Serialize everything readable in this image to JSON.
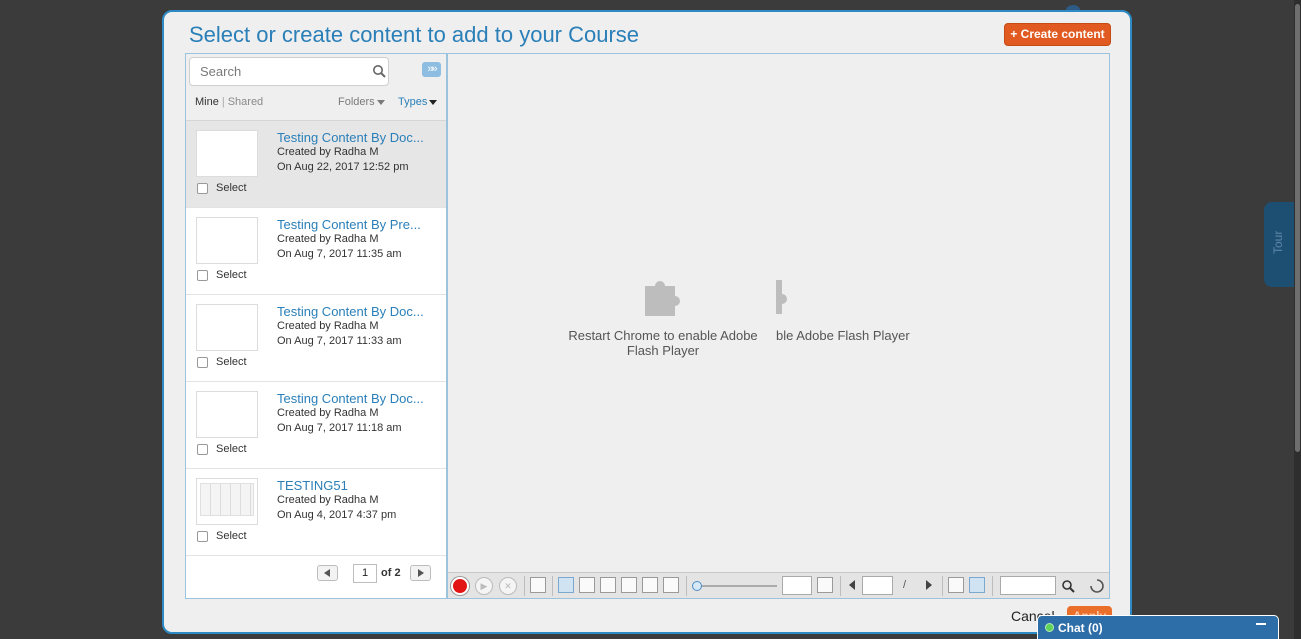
{
  "modal": {
    "title": "Select or create content to add to your Course",
    "create_button": "+ Create content",
    "cancel_label": "Cancel",
    "apply_label": "Apply"
  },
  "left_panel": {
    "search_placeholder": "Search",
    "filter_mine": "Mine",
    "filter_separator": "|",
    "filter_shared": "Shared",
    "folders_label": "Folders",
    "types_label": "Types"
  },
  "items": [
    {
      "title": "Testing Content By Doc...",
      "created_by": "Created by Radha M",
      "date": "On Aug 22, 2017 12:52 pm",
      "select_label": "Select"
    },
    {
      "title": "Testing Content By Pre...",
      "created_by": "Created by Radha M",
      "date": "On Aug 7, 2017 11:35 am",
      "select_label": "Select"
    },
    {
      "title": "Testing Content By Doc...",
      "created_by": "Created by Radha M",
      "date": "On Aug 7, 2017 11:33 am",
      "select_label": "Select"
    },
    {
      "title": "Testing Content By Doc...",
      "created_by": "Created by Radha M",
      "date": "On Aug 7, 2017 11:18 am",
      "select_label": "Select"
    },
    {
      "title": "TESTING51",
      "created_by": "Created by Radha M",
      "date": "On Aug 4, 2017 4:37 pm",
      "select_label": "Select"
    }
  ],
  "pager": {
    "current_page": "1",
    "of_label": "of 2"
  },
  "preview": {
    "plugin_message": "Restart Chrome to enable Adobe Flash Player",
    "plugin_message_partial": "ble Adobe Flash Player"
  },
  "tour_label": "Tour",
  "chat": {
    "label": "Chat  (0)"
  },
  "colors": {
    "accent": "#2a7fb8",
    "create_button": "#e05a21",
    "chat_bar": "#2e6ea8",
    "overlay": "#3b3b3b"
  }
}
